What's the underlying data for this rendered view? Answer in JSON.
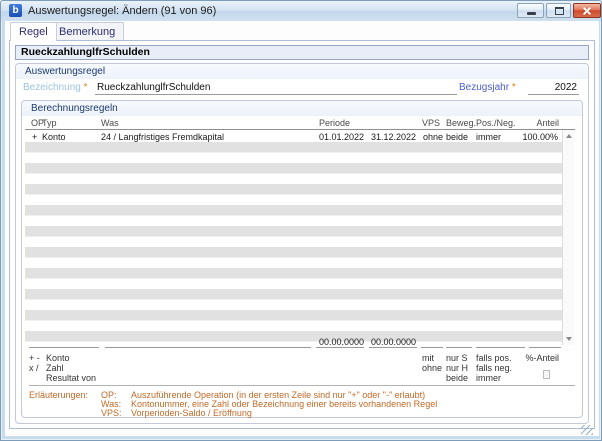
{
  "window": {
    "icon": "b",
    "title": "Auswertungsregel: Ändern (91 von 96)"
  },
  "tabs": [
    {
      "label": "Regel",
      "active": true
    },
    {
      "label": "Bemerkung",
      "active": false
    }
  ],
  "rule_header": "RueckzahlunglfrSchulden",
  "form": {
    "group_title": "Auswertungsregel",
    "bezeichnung": {
      "label": "Bezeichnung",
      "required_mark": "*",
      "value": "RueckzahlunglfrSchulden"
    },
    "bezugsjahr": {
      "label": "Bezugsjahr",
      "required_mark": "*",
      "value": "2022"
    }
  },
  "rules_group": {
    "title": "Berechnungsregeln",
    "table": {
      "columns": [
        "OP",
        "Typ",
        "Was",
        "Periode",
        "",
        "VPS",
        "Beweg.",
        "Pos./Neg.",
        "Anteil"
      ],
      "rows": [
        {
          "op": "+",
          "typ": "Konto",
          "was": "24 / Langfristiges Fremdkapital",
          "periode_von": "01.01.2022",
          "periode_bis": "31.12.2022",
          "vps": "ohne",
          "beweg": "beide",
          "pos_neg": "immer",
          "anteil": "100.00%"
        }
      ]
    },
    "entry_row": {
      "periode_von": "00.00.0000",
      "periode_bis": "00.00.0000"
    },
    "legend": {
      "op": [
        "+ -",
        "x /"
      ],
      "typ": [
        "Konto",
        "Zahl",
        "Resultat von"
      ],
      "vps": [
        "mit",
        "ohne"
      ],
      "beweg": [
        "nur S",
        "nur H",
        "beide"
      ],
      "pos_neg": [
        "falls pos.",
        "falls neg.",
        "immer"
      ],
      "anteil": "%-Anteil"
    }
  },
  "notes": {
    "label": "Erläuterungen:",
    "items": [
      {
        "term": "OP:",
        "text": "Auszuführende Operation (in der ersten Zeile sind nur \"+\" oder \"-\" erlaubt)"
      },
      {
        "term": "Was:",
        "text": "Kontonummer, eine Zahl oder Bezeichnung einer bereits vorhandenen Regel"
      },
      {
        "term": "VPS:",
        "text": "Vorperioden-Saldo / Eröffnung"
      }
    ]
  },
  "colors": {
    "titlebar_blue": "#cfe0f0",
    "close_button_red": "#cf4a2e",
    "focused_label_blue": "#9cc4e4",
    "label_blue": "#4f5fc9",
    "required_orange": "#e0821e",
    "notes_orange": "#c06a28",
    "stripe_gray": "#e1e1e1",
    "group_title_navy": "#1c3a6e"
  }
}
